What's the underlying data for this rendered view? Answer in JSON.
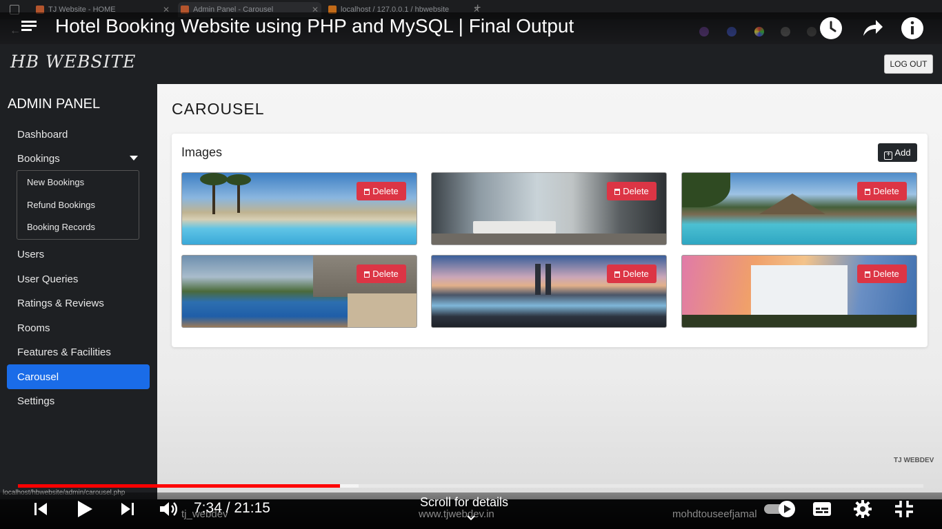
{
  "browser": {
    "tabs": [
      {
        "label": "TJ Website - HOME",
        "active": false
      },
      {
        "label": "Admin Panel - Carousel",
        "active": true
      },
      {
        "label": "localhost / 127.0.0.1 / hbwebsite",
        "active": false
      }
    ],
    "status_url": "localhost/hbwebsite/admin/carousel.php"
  },
  "video": {
    "title": "Hotel Booking Website using PHP and MySQL | Final Output",
    "current_time": "7:34",
    "duration": "21:15",
    "time_display": "7:34 / 21:15",
    "progress_fraction": 0.356,
    "buffered_fraction": 0.376,
    "scroll_hint": "Scroll for details",
    "watermark_site": "www.tjwebdev.in",
    "watermark_instagram": "tj_webdev",
    "watermark_linkedin": "mohdtouseefjamal",
    "corner_watermark": "TJ WEBDEV",
    "icons": [
      "menu-icon",
      "watch-later-icon",
      "share-icon",
      "info-icon",
      "prev-icon",
      "play-icon",
      "next-icon",
      "volume-icon",
      "autoplay-toggle-icon",
      "subtitles-icon",
      "settings-icon",
      "exit-fullscreen-icon",
      "chevron-down-icon"
    ]
  },
  "site": {
    "brand": "HB WEBSITE",
    "logout_label": "LOG OUT"
  },
  "sidebar": {
    "heading": "ADMIN PANEL",
    "dashboard": "Dashboard",
    "bookings": "Bookings",
    "bookings_sub": {
      "new": "New Bookings",
      "refund": "Refund Bookings",
      "records": "Booking Records"
    },
    "users": "Users",
    "user_queries": "User Queries",
    "ratings": "Ratings & Reviews",
    "rooms": "Rooms",
    "features": "Features & Facilities",
    "carousel": "Carousel",
    "settings": "Settings",
    "active_color": "#1a6ce8"
  },
  "main": {
    "page_title": "CAROUSEL",
    "card_title": "Images",
    "add_label": "Add",
    "delete_label": "Delete",
    "delete_color": "#dc3545",
    "images": [
      "beach-pool-palms-image",
      "hotel-lobby-lounge-image",
      "resort-pool-palms-image",
      "infinity-pool-sea-image",
      "rooftop-pool-city-skyline-image",
      "sunset-hotel-tower-image"
    ]
  }
}
